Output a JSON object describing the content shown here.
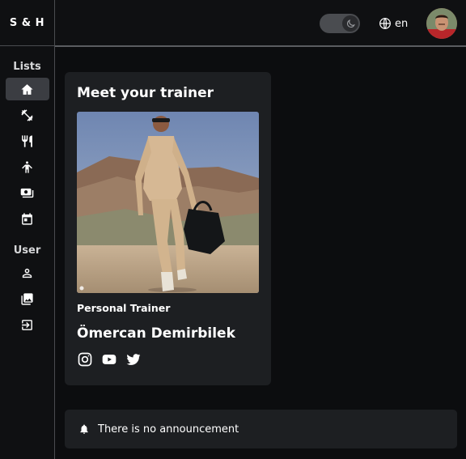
{
  "brand": "S & H",
  "sidebar": {
    "sections": [
      {
        "title": "Lists",
        "items": [
          {
            "icon": "home-icon",
            "active": true
          },
          {
            "icon": "dumbbell-icon",
            "active": false
          },
          {
            "icon": "utensils-icon",
            "active": false
          },
          {
            "icon": "person-icon",
            "active": false
          },
          {
            "icon": "money-icon",
            "active": false
          },
          {
            "icon": "calendar-icon",
            "active": false
          }
        ]
      },
      {
        "title": "User",
        "items": [
          {
            "icon": "profile-icon",
            "active": false
          },
          {
            "icon": "gallery-icon",
            "active": false
          },
          {
            "icon": "logout-icon",
            "active": false
          }
        ]
      }
    ]
  },
  "topbar": {
    "theme_toggle": "dark",
    "language": "en"
  },
  "trainer_card": {
    "title": "Meet your trainer",
    "role": "Personal Trainer",
    "name": "Ömercan Demirbilek",
    "socials": [
      "instagram-icon",
      "youtube-icon",
      "twitter-icon"
    ]
  },
  "announcement": {
    "text": "There is no announcement"
  }
}
